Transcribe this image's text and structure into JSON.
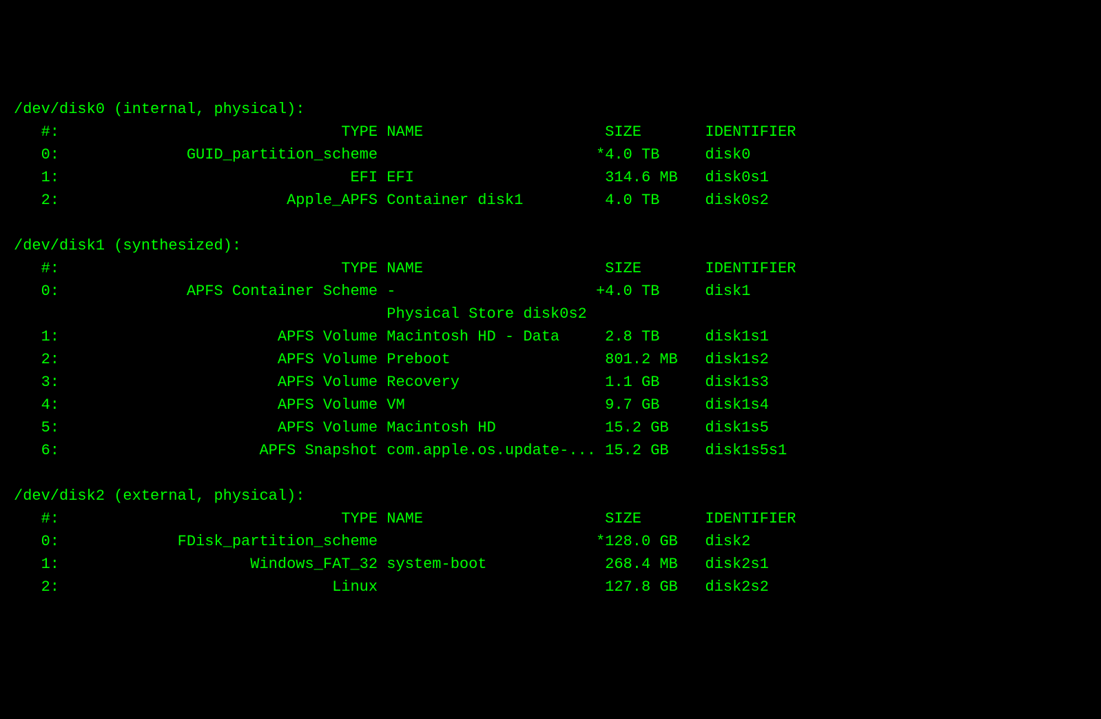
{
  "headers": {
    "index": "#:",
    "type": "TYPE",
    "name": "NAME",
    "size": "SIZE",
    "identifier": "IDENTIFIER"
  },
  "disks": [
    {
      "device": "/dev/disk0",
      "qualifier": "(internal, physical):",
      "partitions": [
        {
          "index": "0:",
          "type": "GUID_partition_scheme",
          "name": "",
          "size": "*4.0 TB",
          "identifier": "disk0"
        },
        {
          "index": "1:",
          "type": "EFI",
          "name": "EFI",
          "size": "314.6 MB",
          "identifier": "disk0s1"
        },
        {
          "index": "2:",
          "type": "Apple_APFS",
          "name": "Container disk1",
          "size": "4.0 TB",
          "identifier": "disk0s2"
        }
      ],
      "extra_lines": []
    },
    {
      "device": "/dev/disk1",
      "qualifier": "(synthesized):",
      "partitions": [
        {
          "index": "0:",
          "type": "APFS Container Scheme",
          "name": "-",
          "size": "+4.0 TB",
          "identifier": "disk1",
          "after": "Physical Store disk0s2"
        },
        {
          "index": "1:",
          "type": "APFS Volume",
          "name": "Macintosh HD - Data",
          "size": "2.8 TB",
          "identifier": "disk1s1"
        },
        {
          "index": "2:",
          "type": "APFS Volume",
          "name": "Preboot",
          "size": "801.2 MB",
          "identifier": "disk1s2"
        },
        {
          "index": "3:",
          "type": "APFS Volume",
          "name": "Recovery",
          "size": "1.1 GB",
          "identifier": "disk1s3"
        },
        {
          "index": "4:",
          "type": "APFS Volume",
          "name": "VM",
          "size": "9.7 GB",
          "identifier": "disk1s4"
        },
        {
          "index": "5:",
          "type": "APFS Volume",
          "name": "Macintosh HD",
          "size": "15.2 GB",
          "identifier": "disk1s5"
        },
        {
          "index": "6:",
          "type": "APFS Snapshot",
          "name": "com.apple.os.update-...",
          "size": "15.2 GB",
          "identifier": "disk1s5s1"
        }
      ]
    },
    {
      "device": "/dev/disk2",
      "qualifier": "(external, physical):",
      "partitions": [
        {
          "index": "0:",
          "type": "FDisk_partition_scheme",
          "name": "",
          "size": "*128.0 GB",
          "identifier": "disk2"
        },
        {
          "index": "1:",
          "type": "Windows_FAT_32",
          "name": "system-boot",
          "size": "268.4 MB",
          "identifier": "disk2s1"
        },
        {
          "index": "2:",
          "type": "Linux",
          "name": "",
          "size": "127.8 GB",
          "identifier": "disk2s2"
        }
      ]
    }
  ],
  "column_widths": {
    "indent": 3,
    "index": 4,
    "type_gap": 33,
    "name": 24,
    "size": 11,
    "identifier": 12
  }
}
